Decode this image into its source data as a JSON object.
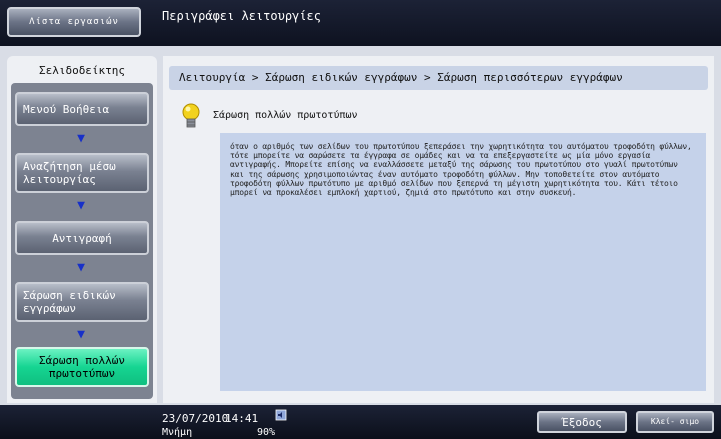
{
  "topbar": {
    "job_list_button": "Λίστα εργασιών",
    "title": "Περιγράφει λειτουργίες"
  },
  "sidebar": {
    "header": "Σελιδοδείκτης",
    "items": [
      {
        "label": "Μενού Βοήθεια"
      },
      {
        "label": "Αναζήτηση μέσω λειτουργίας"
      },
      {
        "label": "Αντιγραφή"
      },
      {
        "label": "Σάρωση ειδικών εγγράφων"
      },
      {
        "label": "Σάρωση πολλών πρωτοτύπων"
      }
    ]
  },
  "main": {
    "breadcrumb": "Λειτουργία > Σάρωση ειδικών εγγράφων > Σάρωση περισσότερων εγγράφων",
    "title": "Σάρωση πολλών πρωτοτύπων",
    "description": "όταν ο αριθμός των σελίδων του πρωτοτύπου ξεπεράσει την χωρητικότητα του αυτόματου τροφοδότη φύλλων, τότε μπορείτε να σαρώσετε τα έγγραφα σε ομάδες και να τα επεξεργαστείτε ως μία μόνο εργασία αντιγραφής. Μπορείτε επίσης να εναλλάσσετε μεταξύ της σάρωσης του πρωτοτύπου στο γυαλί πρωτοτύπων και της σάρωσης χρησιμοποιώντας έναν αυτόματο τροφοδότη φύλλων. Μην τοποθετείτε στον αυτόματο τροφοδότη φύλλων πρωτότυπο με αριθμό σελίδων που ξεπερνά τη μέγιστη χωρητικότητα του. Κάτι τέτοιο μπορεί να προκαλέσει εμπλοκή χαρτιού, ζημιά στο πρωτότυπο και στην συσκευή."
  },
  "status": {
    "date": "23/07/2010",
    "time": "14:41",
    "memory_label": "Μνήμη",
    "memory_value": "90%"
  },
  "footer": {
    "exit_label": "Έξοδος",
    "close_label": "Κλεί- σιμο"
  },
  "colors": {
    "active_item": "#16d592",
    "arrow": "#1730c9",
    "desc_bg": "#c5d2ea"
  }
}
